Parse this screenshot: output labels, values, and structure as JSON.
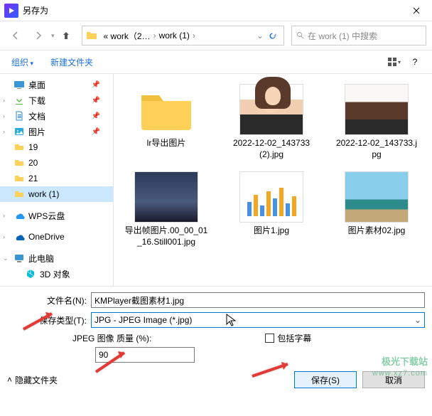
{
  "titlebar": {
    "title": "另存为"
  },
  "breadcrumb": {
    "part1": "« work（2…",
    "part2": "work (1)"
  },
  "search": {
    "placeholder": "在 work (1) 中搜索"
  },
  "toolbar": {
    "organize": "组织",
    "newfolder": "新建文件夹"
  },
  "sidebar": {
    "desktop": "桌面",
    "downloads": "下载",
    "documents": "文档",
    "pictures": "图片",
    "f19": "19",
    "f20": "20",
    "f21": "21",
    "work1": "work (1)",
    "wps": "WPS云盘",
    "onedrive": "OneDrive",
    "thispc": "此电脑",
    "obj3d": "3D 对象"
  },
  "files": {
    "f1": "lr导出图片",
    "f2": "2022-12-02_143733 (2).jpg",
    "f3": "2022-12-02_143733.jpg",
    "f4": "导出帧图片.00_00_01_16.Still001.jpg",
    "f5": "图片1.jpg",
    "f6": "图片素材02.jpg"
  },
  "form": {
    "filename_label": "文件名(N):",
    "filename_value": "KMPlayer截图素材1.jpg",
    "filetype_label": "保存类型(T):",
    "filetype_value": "JPG - JPEG Image (*.jpg)",
    "jpeg_quality_label": "JPEG 图像 质量 (%):",
    "jpeg_quality_value": "90",
    "subtitle_label": "包括字幕"
  },
  "footer": {
    "hidefolders": "隐藏文件夹",
    "save": "保存(S)",
    "cancel": "取消"
  },
  "watermark": {
    "line1": "极光下载站",
    "line2": "www.xz7.com"
  }
}
